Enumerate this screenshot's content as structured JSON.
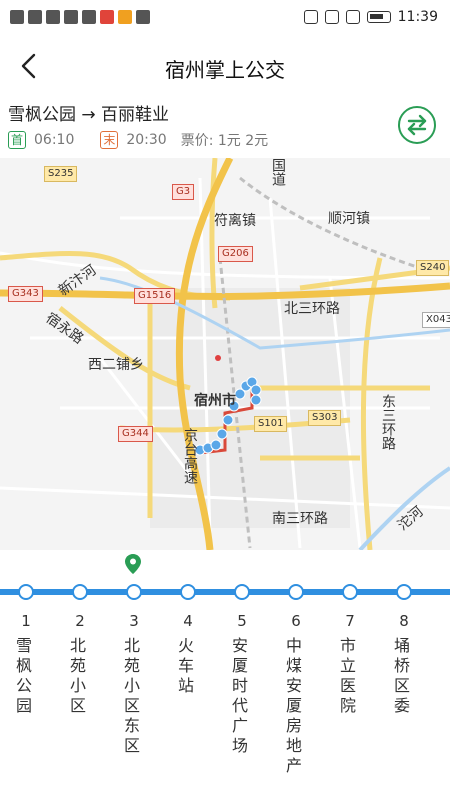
{
  "status_bar": {
    "time": "11:39",
    "icons": [
      "hd-icon",
      "signal-5g-icon",
      "wifi-icon",
      "heart-icon",
      "app-icon",
      "app-icon",
      "app-icon",
      "cart-icon",
      "nfc-icon",
      "silent-icon",
      "vibrate-icon",
      "battery-icon"
    ]
  },
  "header": {
    "title": "宿州掌上公交"
  },
  "route": {
    "name": "雪枫公园 → 百丽鞋业",
    "first_badge": "首",
    "first_time": "06:10",
    "last_badge": "末",
    "last_time": "20:30",
    "price": "票价: 1元 2元"
  },
  "map": {
    "labels": {
      "guodao": "国道",
      "fulizhen": "符离镇",
      "shunhezhen": "顺河镇",
      "xinbianhe": "新汴河",
      "beisanhuan": "北三环路",
      "suyonglu": "宿永路",
      "xierpu": "西二铺乡",
      "suzhoushi": "宿州市",
      "jingtai": "京台高速",
      "dongsanhuan": "东三环路",
      "nansanhuan": "南三环路",
      "tuohe": "沱河"
    },
    "road_tags": {
      "s235": "S235",
      "g3": "G3",
      "g206": "G206",
      "s240": "S240",
      "g343": "G343",
      "g1516": "G1516",
      "x043": "X043",
      "s303": "S303",
      "s101": "S101",
      "g344": "G344"
    }
  },
  "stations": [
    {
      "num": "1",
      "name": "雪枫公园"
    },
    {
      "num": "2",
      "name": "北苑小区"
    },
    {
      "num": "3",
      "name": "北苑小区东区"
    },
    {
      "num": "4",
      "name": "火车站"
    },
    {
      "num": "5",
      "name": "安厦时代广场"
    },
    {
      "num": "6",
      "name": "中煤安厦房地产"
    },
    {
      "num": "7",
      "name": "市立医院"
    },
    {
      "num": "8",
      "name": "埇桥区委"
    }
  ],
  "colors": {
    "line": "#2f8fe0",
    "accent": "#2a9d55",
    "highway": "#f2c34a",
    "national_road": "#f5d97a"
  }
}
